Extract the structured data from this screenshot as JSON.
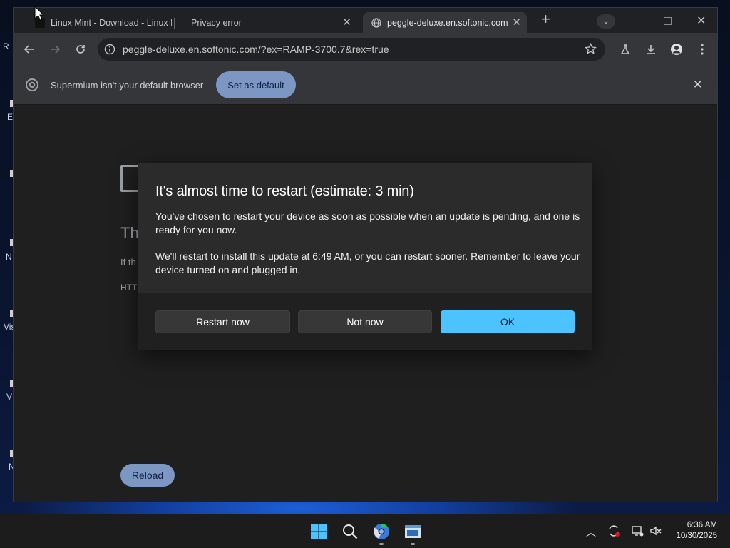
{
  "tabs": [
    {
      "title": "Linux Mint - Download - Linux M",
      "active": false
    },
    {
      "title": "Privacy error",
      "active": false
    },
    {
      "title": "peggle-deluxe.en.softonic.com",
      "active": true
    }
  ],
  "omnibox": {
    "url": "peggle-deluxe.en.softonic.com/?ex=RAMP-3700.7&rex=true"
  },
  "infobar": {
    "message": "Supermium isn't your default browser",
    "button_label": "Set as default"
  },
  "error_page": {
    "title_fragment": "Th",
    "line1_fragment": "If th",
    "line2_fragment": "HTTP",
    "reload_label": "Reload"
  },
  "dialog": {
    "title": "It's almost time to restart (estimate: 3 min)",
    "paragraph1": "You've chosen to restart your device as soon as possible when an update is pending, and one is ready for you now.",
    "paragraph2": "We'll restart to install this update at 6:49 AM, or you can restart sooner. Remember to leave your device turned on and plugged in.",
    "buttons": {
      "restart_now": "Restart now",
      "not_now": "Not now",
      "ok": "OK"
    }
  },
  "desktop_fragments": [
    "R",
    "E",
    "N",
    "Vis",
    "V",
    "N"
  ],
  "taskbar": {
    "time": "6:36 AM",
    "date": "10/30/2025"
  },
  "colors": {
    "accent": "#4cc2ff",
    "chrome_button": "#7d97c4"
  }
}
